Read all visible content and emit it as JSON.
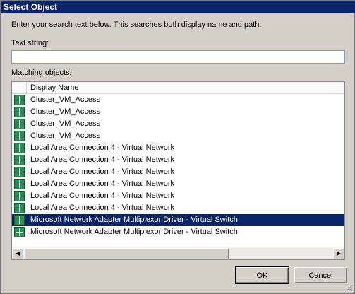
{
  "window": {
    "title": "Select Object"
  },
  "instructions": "Enter your search text below. This searches both display name and path.",
  "text_string": {
    "label": "Text string:",
    "value": "",
    "placeholder": ""
  },
  "matching": {
    "label": "Matching objects:",
    "column_header": "Display Name",
    "items": [
      {
        "label": "Cluster_VM_Access",
        "selected": false
      },
      {
        "label": "Cluster_VM_Access",
        "selected": false
      },
      {
        "label": "Cluster_VM_Access",
        "selected": false
      },
      {
        "label": "Cluster_VM_Access",
        "selected": false
      },
      {
        "label": "Local Area Connection 4 - Virtual Network",
        "selected": false
      },
      {
        "label": "Local Area Connection 4 - Virtual Network",
        "selected": false
      },
      {
        "label": "Local Area Connection 4 - Virtual Network",
        "selected": false
      },
      {
        "label": "Local Area Connection 4 - Virtual Network",
        "selected": false
      },
      {
        "label": "Local Area Connection 4 - Virtual Network",
        "selected": false
      },
      {
        "label": "Local Area Connection 4 - Virtual Network",
        "selected": false
      },
      {
        "label": "Microsoft Network Adapter Multiplexor Driver - Virtual Switch",
        "selected": true
      },
      {
        "label": "Microsoft Network Adapter Multiplexor Driver - Virtual Switch",
        "selected": false
      }
    ]
  },
  "buttons": {
    "ok": "OK",
    "cancel": "Cancel"
  },
  "colors": {
    "title_bar": "#0a246a",
    "selection": "#0a246a",
    "dialog_bg": "#d4d0c8",
    "network_icon": "#2e8b57"
  }
}
